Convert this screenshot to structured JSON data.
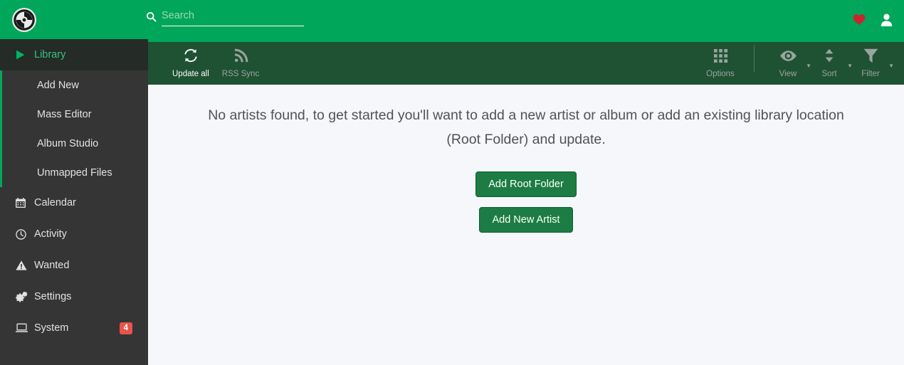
{
  "header": {
    "logo_icon": "lidarr-logo-icon",
    "search": {
      "placeholder": "Search",
      "value": "",
      "icon": "search-icon"
    },
    "donate_icon": "heart-icon",
    "account_icon": "user-icon"
  },
  "sidebar": {
    "sections": [
      {
        "label": "Library",
        "icon": "play-icon",
        "active": true,
        "children": [
          {
            "label": "Add New"
          },
          {
            "label": "Mass Editor"
          },
          {
            "label": "Album Studio"
          },
          {
            "label": "Unmapped Files"
          }
        ]
      },
      {
        "label": "Calendar",
        "icon": "calendar-icon",
        "active": false,
        "children": []
      },
      {
        "label": "Activity",
        "icon": "clock-icon",
        "active": false,
        "children": []
      },
      {
        "label": "Wanted",
        "icon": "warning-triangle-icon",
        "active": false,
        "children": []
      },
      {
        "label": "Settings",
        "icon": "cogs-icon",
        "active": false,
        "children": []
      },
      {
        "label": "System",
        "icon": "laptop-icon",
        "active": false,
        "badge": "4",
        "children": []
      }
    ]
  },
  "toolbar": {
    "left_buttons": [
      {
        "label": "Update all",
        "icon": "refresh-icon",
        "state": "bright",
        "caret": false
      },
      {
        "label": "RSS Sync",
        "icon": "rss-icon",
        "state": "dim",
        "caret": false
      }
    ],
    "right_buttons": [
      {
        "label": "Options",
        "icon": "grid-icon",
        "state": "dim",
        "caret": false
      },
      {
        "label": "View",
        "icon": "eye-icon",
        "state": "dim",
        "caret": true
      },
      {
        "label": "Sort",
        "icon": "sort-arrows-icon",
        "state": "dim",
        "caret": true
      },
      {
        "label": "Filter",
        "icon": "funnel-icon",
        "state": "dim",
        "caret": true
      }
    ]
  },
  "main": {
    "empty_message": "No artists found, to get started you'll want to add a new artist or album or add an existing library location (Root Folder) and update.",
    "buttons": [
      {
        "label": "Add Root Folder"
      },
      {
        "label": "Add New Artist"
      }
    ]
  },
  "colors": {
    "brand_green": "#00a65a",
    "toolbar_green": "#1f5233",
    "sidebar_dark": "#353535",
    "sidebar_active": "#252b26",
    "content_bg": "#f5f7fa",
    "button_green": "#1c7c43",
    "badge_red": "#e8544c",
    "heart_red": "#c9252d"
  }
}
